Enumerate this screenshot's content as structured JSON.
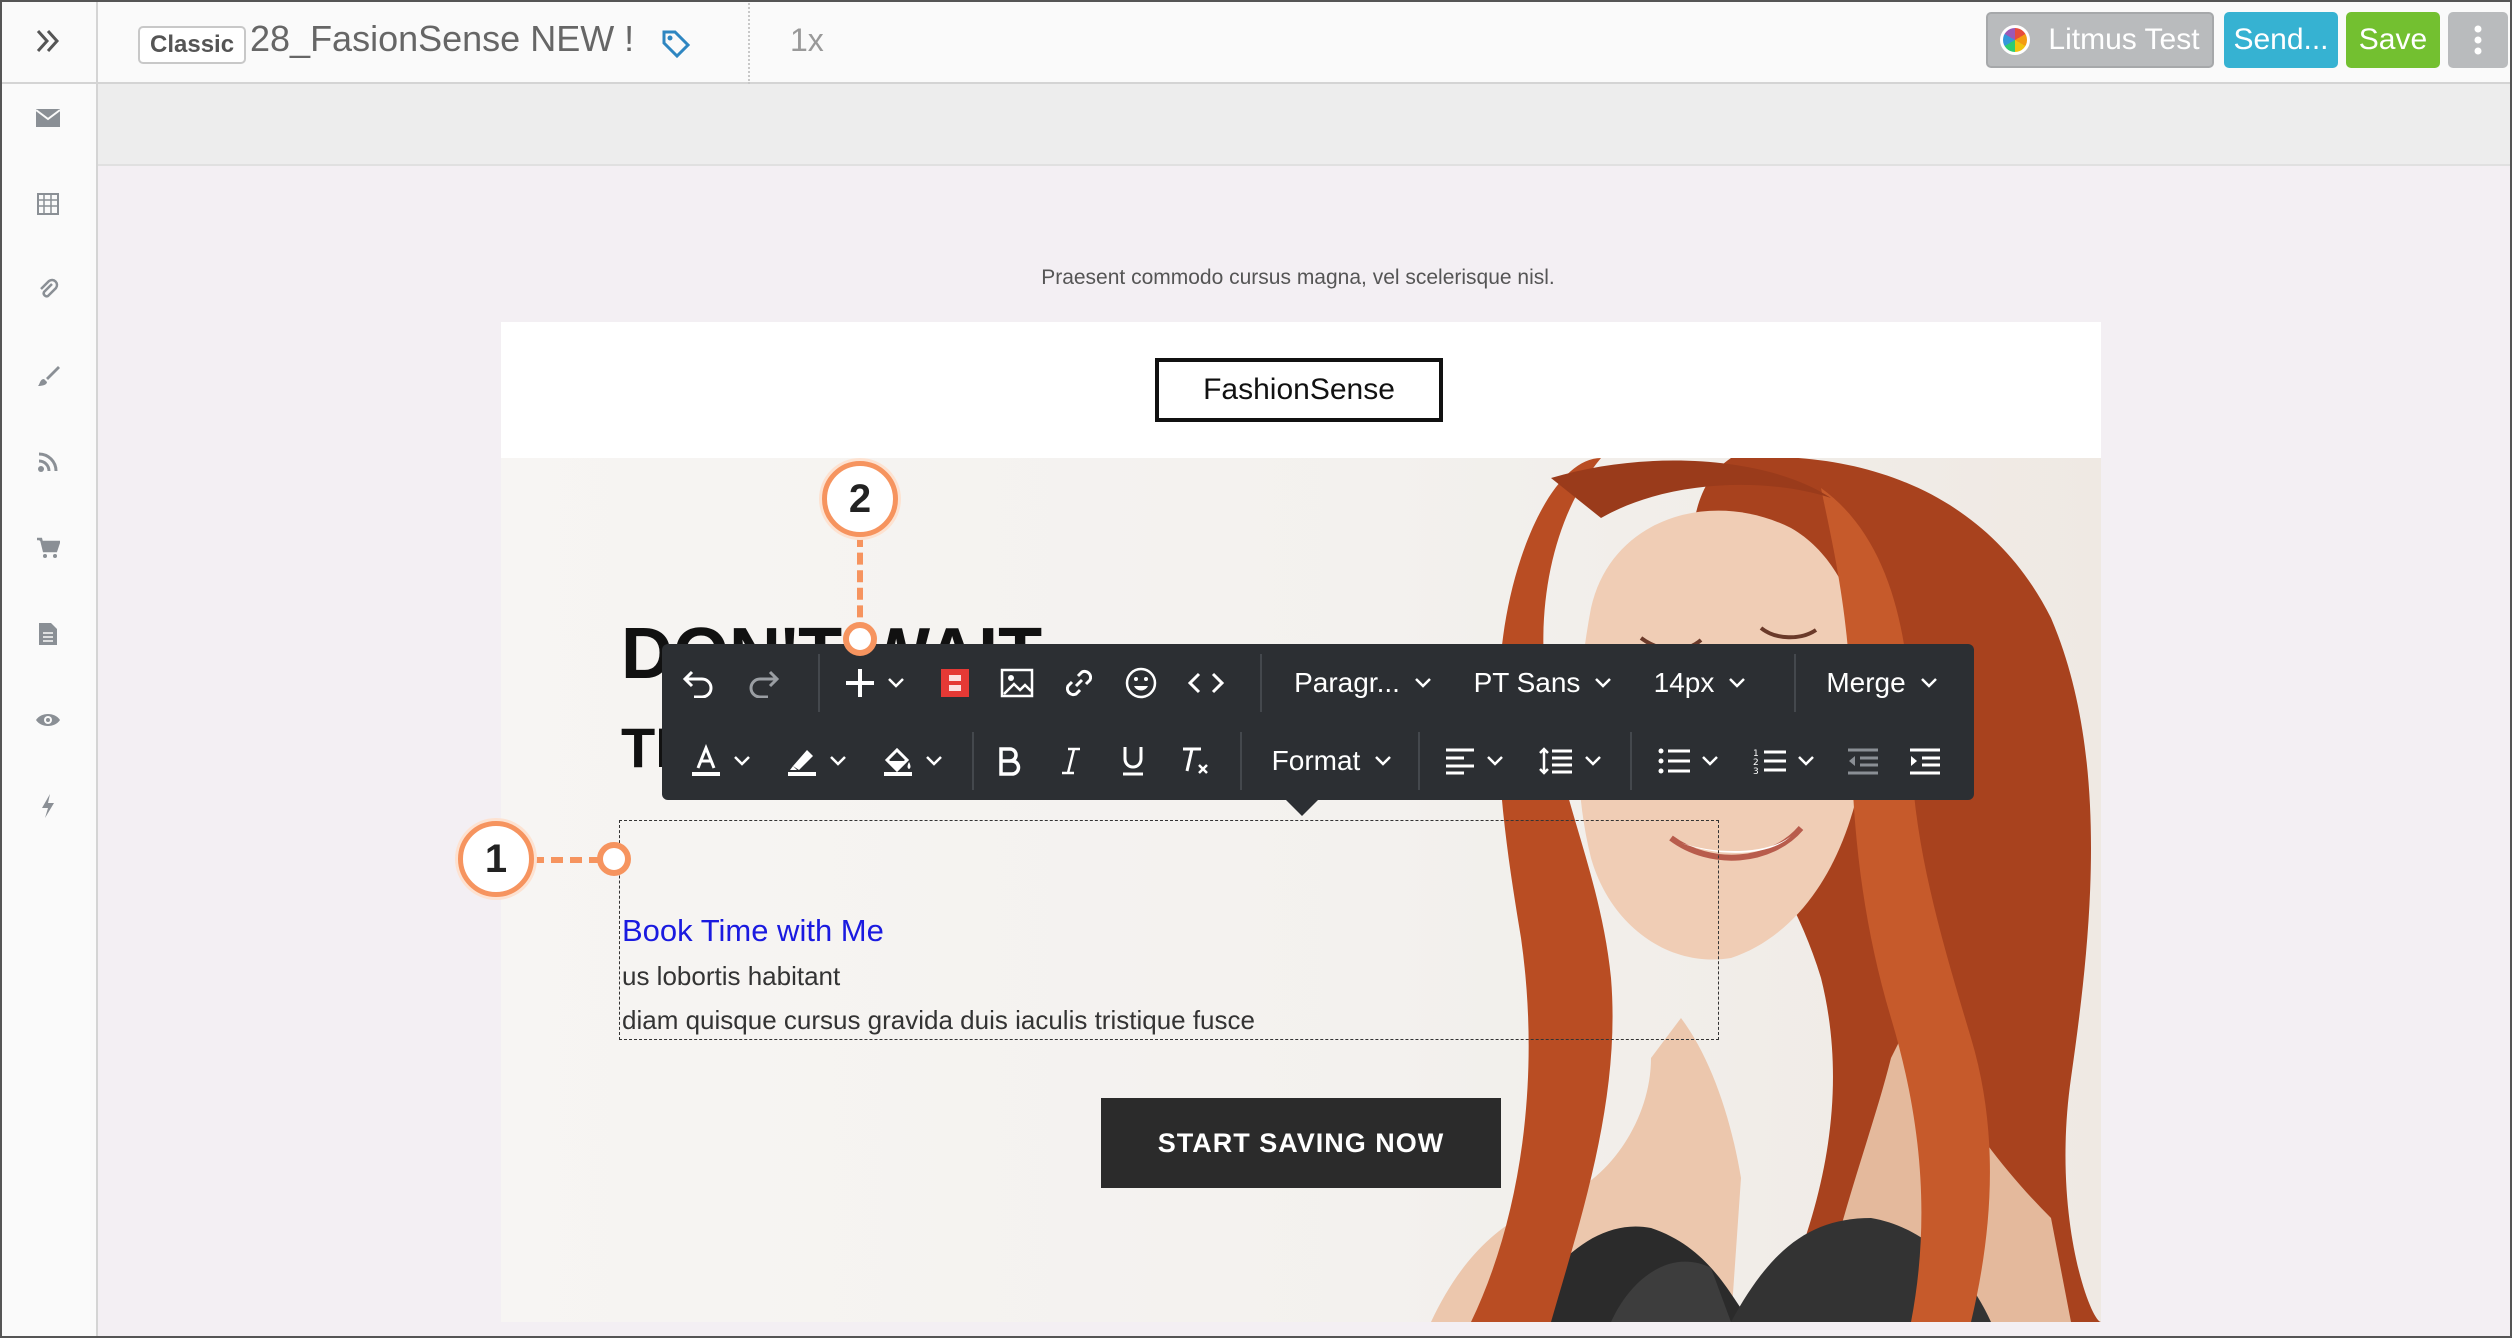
{
  "topbar": {
    "editor_mode": "Classic",
    "title": "28_FasionSense NEW !",
    "zoom": "1x",
    "litmus_label": "Litmus Test",
    "send_label": "Send...",
    "save_label": "Save"
  },
  "sidebar": {
    "items": [
      "mail-icon",
      "grid-icon",
      "paperclip-icon",
      "brush-icon",
      "rss-icon",
      "cart-icon",
      "document-icon",
      "eye-icon",
      "bolt-icon"
    ]
  },
  "email": {
    "preheader": "Praesent commodo cursus magna, vel scelerisque nisl.",
    "logo": "FashionSense",
    "headline_1": "DON'T WAIT",
    "headline_2": "TI",
    "link_text": "Book Time with Me",
    "line_1": "us lobortis habitant",
    "line_2": "diam quisque cursus gravida duis iaculis tristique fusce",
    "cta": "START SAVING NOW"
  },
  "toolbar": {
    "paragraph": "Paragr...",
    "font": "PT Sans",
    "size": "14px",
    "merge": "Merge",
    "format": "Format"
  },
  "callouts": {
    "one": "1",
    "two": "2"
  },
  "colors": {
    "accent": "#f6945f",
    "send": "#36b2d2",
    "save": "#73c030",
    "link": "#1a1ae0"
  }
}
